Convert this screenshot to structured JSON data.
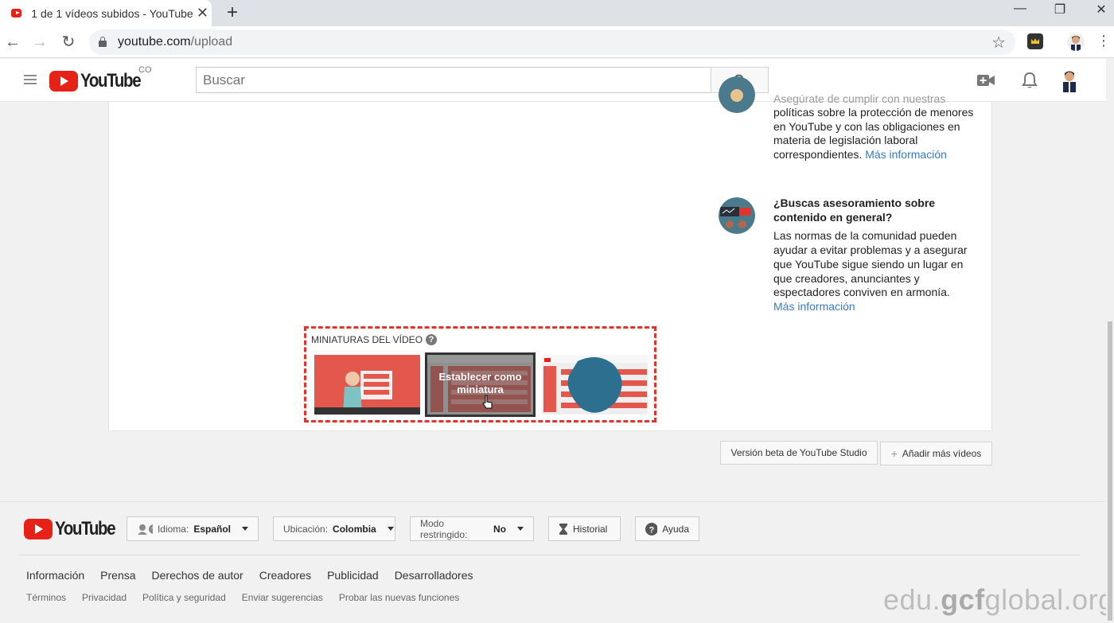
{
  "browser": {
    "tab_title": "1 de 1 vídeos subidos - YouTube",
    "url_host": "youtube.com",
    "url_path": "/upload"
  },
  "header": {
    "logo_text": "YouTube",
    "country_code": "CO",
    "search_placeholder": "Buscar"
  },
  "side_panel": {
    "item1": {
      "partial_title": "Asegúrate de cumplir con nuestras",
      "text": "políticas sobre la protección de menores en YouTube y con las obligaciones en materia de legislación laboral correspondientes.",
      "link": "Más información"
    },
    "item2": {
      "title": "¿Buscas asesoramiento sobre contenido en general?",
      "text": "Las normas de la comunidad pueden ayudar a evitar problemas y a asegurar que YouTube sigue siendo un lugar en que creadores, anunciantes y espectadores conviven en armonía.",
      "link": "Más información"
    }
  },
  "thumbnails": {
    "label": "MINIATURAS DEL VÍDEO",
    "help": "?",
    "overlay": "Establecer como miniatura"
  },
  "actions": {
    "studio_beta": "Versión beta de YouTube Studio",
    "add_more": "Añadir más vídeos"
  },
  "footer": {
    "logo_text": "YouTube",
    "language_label": "Idioma:",
    "language_value": "Español",
    "location_label": "Ubicación:",
    "location_value": "Colombia",
    "restricted_label": "Modo restringido:",
    "restricted_value": "No",
    "history": "Historial",
    "help": "Ayuda",
    "links": [
      "Información",
      "Prensa",
      "Derechos de autor",
      "Creadores",
      "Publicidad",
      "Desarrolladores"
    ],
    "small_links": [
      "Términos",
      "Privacidad",
      "Política y seguridad",
      "Enviar sugerencias",
      "Probar las nuevas funciones"
    ]
  },
  "watermark": {
    "prefix": "edu.",
    "brand": "gcf",
    "suffix": "global.org"
  },
  "colors": {
    "youtube_red": "#e62117",
    "link_blue": "#367bc4",
    "dashed_highlight": "#e0342f"
  }
}
